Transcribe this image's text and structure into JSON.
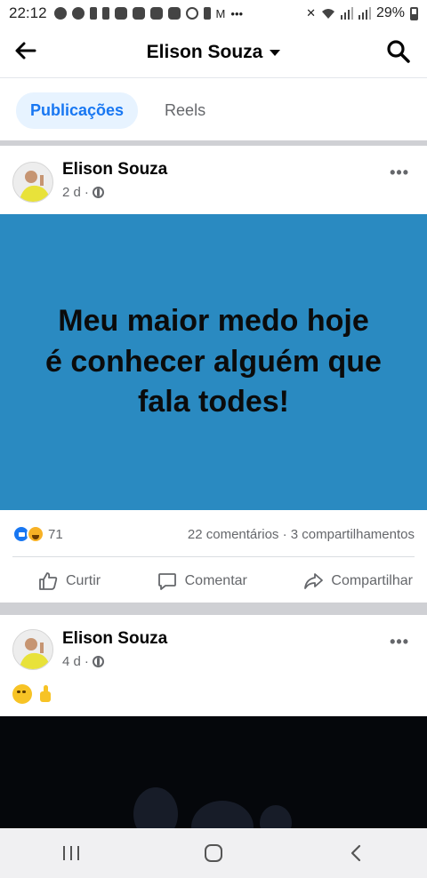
{
  "status_bar": {
    "time": "22:12",
    "battery": "29%"
  },
  "header": {
    "title": "Elison Souza",
    "icons": [
      "back-arrow-icon",
      "chevron-down-icon",
      "search-icon"
    ]
  },
  "tabs": [
    {
      "label": "Publicações",
      "active": true
    },
    {
      "label": "Reels",
      "active": false
    }
  ],
  "posts": [
    {
      "author": "Elison Souza",
      "time": "2 d",
      "separator": "·",
      "image_text": "Meu maior medo hoje\né conhecer alguém que\nfala todes!",
      "image_bg": "#2a8ac1",
      "reactions": {
        "count": "71",
        "summary": "22 comentários · 3 compartilhamentos",
        "icons": [
          "like-reaction-icon",
          "haha-reaction-icon"
        ]
      },
      "actions": {
        "like": "Curtir",
        "comment": "Comentar",
        "share": "Compartilhar"
      }
    },
    {
      "author": "Elison Souza",
      "time": "4 d",
      "separator": "·",
      "emojis": [
        "smirk-emoji",
        "thumbs-up-emoji"
      ]
    }
  ],
  "colors": {
    "accent": "#1877f2",
    "tab_active_bg": "#e7f3ff",
    "secondary_text": "#65676b"
  }
}
